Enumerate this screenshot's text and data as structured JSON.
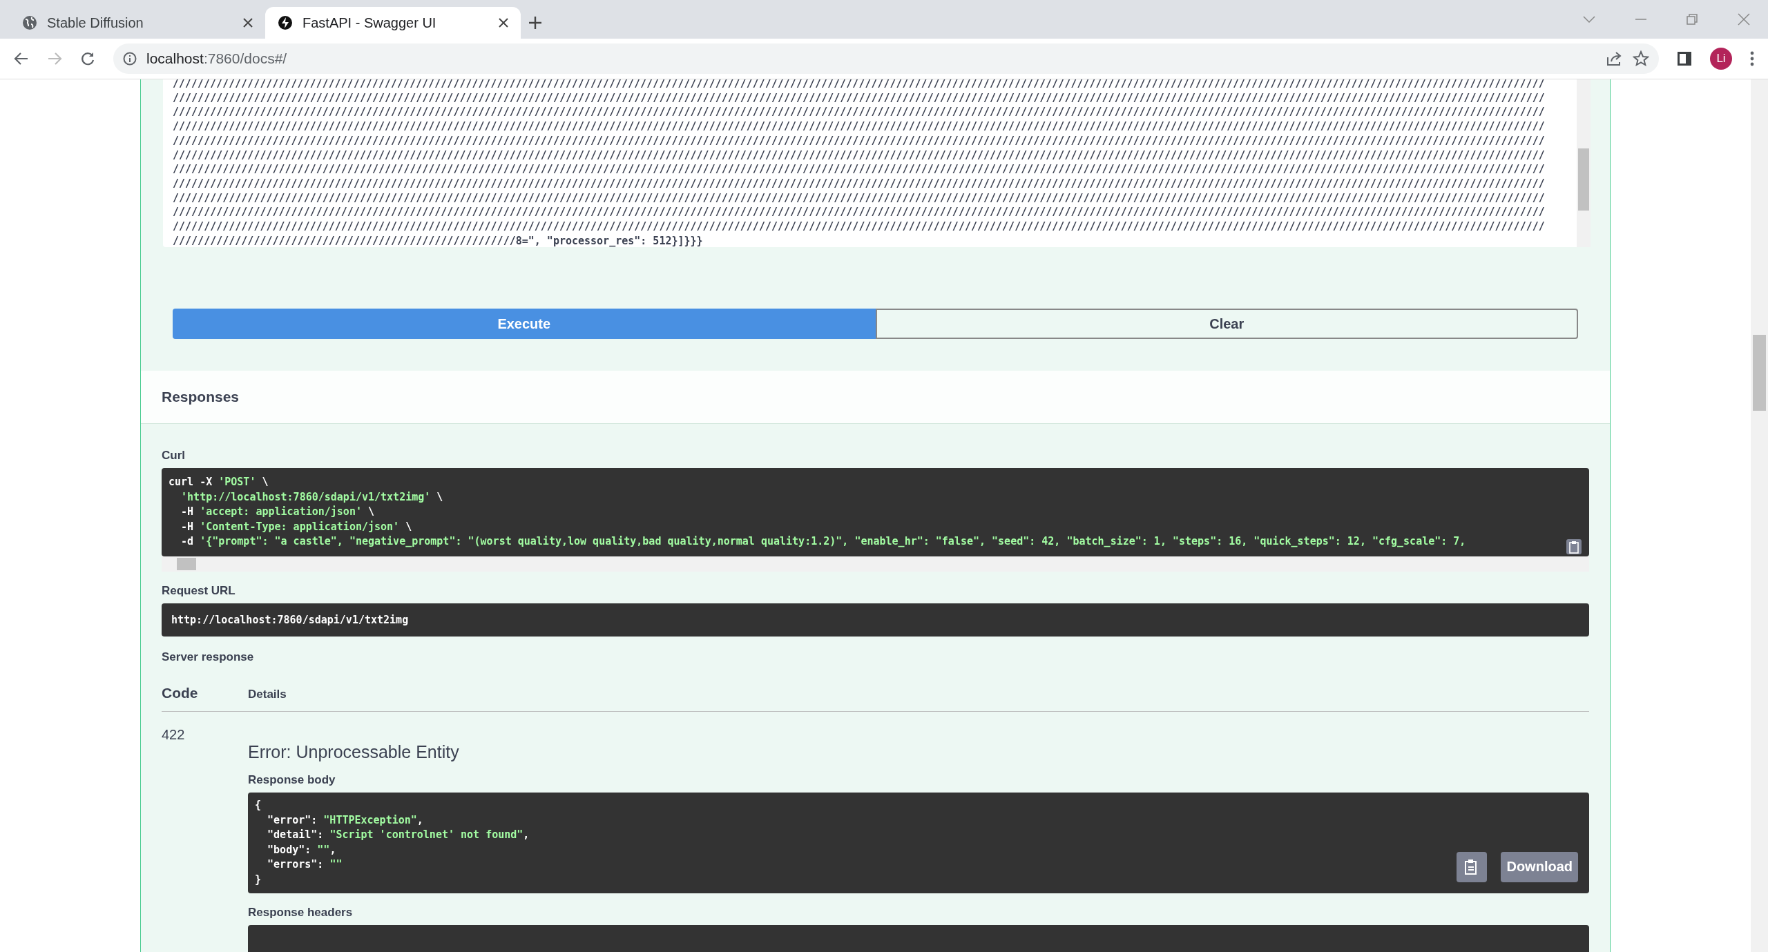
{
  "browser": {
    "tabs": [
      {
        "title": "Stable Diffusion",
        "selected": false
      },
      {
        "title": "FastAPI - Swagger UI",
        "selected": true
      }
    ],
    "address": {
      "host": "localhost",
      "rest": ":7860/docs#/"
    },
    "profile": "Li"
  },
  "request_body": {
    "lines": [
      "////////////////////////////////////////////////////////////////////////////////////////////////////////////////////////////////////////////////////////////////////////////////////////////////////////////////////////////",
      "////////////////////////////////////////////////////////////////////////////////////////////////////////////////////////////////////////////////////////////////////////////////////////////////////////////////////////////",
      "////////////////////////////////////////////////////////////////////////////////////////////////////////////////////////////////////////////////////////////////////////////////////////////////////////////////////////////",
      "////////////////////////////////////////////////////////////////////////////////////////////////////////////////////////////////////////////////////////////////////////////////////////////////////////////////////////////",
      "////////////////////////////////////////////////////////////////////////////////////////////////////////////////////////////////////////////////////////////////////////////////////////////////////////////////////////////",
      "////////////////////////////////////////////////////////////////////////////////////////////////////////////////////////////////////////////////////////////////////////////////////////////////////////////////////////////",
      "////////////////////////////////////////////////////////////////////////////////////////////////////////////////////////////////////////////////////////////////////////////////////////////////////////////////////////////",
      "////////////////////////////////////////////////////////////////////////////////////////////////////////////////////////////////////////////////////////////////////////////////////////////////////////////////////////////",
      "////////////////////////////////////////////////////////////////////////////////////////////////////////////////////////////////////////////////////////////////////////////////////////////////////////////////////////////",
      "////////////////////////////////////////////////////////////////////////////////////////////////////////////////////////////////////////////////////////////////////////////////////////////////////////////////////////////",
      "////////////////////////////////////////////////////////////////////////////////////////////////////////////////////////////////////////////////////////////////////////////////////////////////////////////////////////////"
    ],
    "last_line": "///////////////////////////////////////////////////////8=\", \"processor_res\": 512}]}}}"
  },
  "buttons": [
    {
      "label": "Execute",
      "kind": "primary"
    },
    {
      "label": "Clear",
      "kind": "secondary"
    }
  ],
  "responses": {
    "title": "Responses",
    "curl": {
      "label": "Curl",
      "lines": [
        [
          {
            "text": "curl -X ",
            "kind": "plain"
          },
          {
            "text": "'POST'",
            "kind": "string"
          },
          {
            "text": " \\",
            "kind": "plain"
          }
        ],
        [
          {
            "text": "  'http://localhost:7860/sdapi/v1/txt2img'",
            "kind": "string"
          },
          {
            "text": " \\",
            "kind": "plain"
          }
        ],
        [
          {
            "text": "  -H ",
            "kind": "plain"
          },
          {
            "text": "'accept: application/json'",
            "kind": "string"
          },
          {
            "text": " \\",
            "kind": "plain"
          }
        ],
        [
          {
            "text": "  -H ",
            "kind": "plain"
          },
          {
            "text": "'Content-Type: application/json'",
            "kind": "string"
          },
          {
            "text": " \\",
            "kind": "plain"
          }
        ],
        [
          {
            "text": "  -d ",
            "kind": "plain"
          },
          {
            "text": "'{\"prompt\": \"a castle\", \"negative_prompt\": \"(worst quality,low quality,bad quality,normal quality:1.2)\", \"enable_hr\": \"false\", \"seed\": 42, \"batch_size\": 1, \"steps\": 16, \"quick_steps\": 12, \"cfg_scale\": 7,",
            "kind": "string"
          }
        ]
      ]
    },
    "request_url": {
      "label": "Request URL",
      "value": "http://localhost:7860/sdapi/v1/txt2img"
    },
    "server_response": {
      "label": "Server response",
      "columns": [
        "Code",
        "Details"
      ],
      "code": "422",
      "error": "Error: Unprocessable Entity",
      "body_label": "Response body",
      "body_lines": [
        [
          {
            "text": "{",
            "kind": "plain"
          }
        ],
        [
          {
            "text": "  \"error\": ",
            "kind": "plain"
          },
          {
            "text": "\"HTTPException\"",
            "kind": "string"
          },
          {
            "text": ",",
            "kind": "plain"
          }
        ],
        [
          {
            "text": "  \"detail\": ",
            "kind": "plain"
          },
          {
            "text": "\"Script 'controlnet' not found\"",
            "kind": "string"
          },
          {
            "text": ",",
            "kind": "plain"
          }
        ],
        [
          {
            "text": "  \"body\": ",
            "kind": "plain"
          },
          {
            "text": "\"\"",
            "kind": "string"
          },
          {
            "text": ",",
            "kind": "plain"
          }
        ],
        [
          {
            "text": "  \"errors\": ",
            "kind": "plain"
          },
          {
            "text": "\"\"",
            "kind": "string"
          }
        ],
        [
          {
            "text": "}",
            "kind": "plain"
          }
        ]
      ],
      "download": "Download",
      "headers_label": "Response headers"
    }
  }
}
